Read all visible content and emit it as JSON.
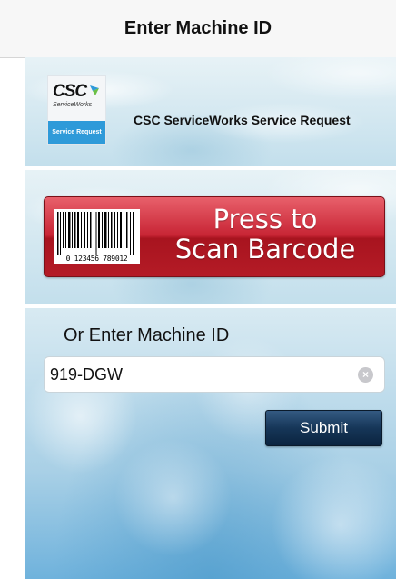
{
  "nav": {
    "title": "Enter Machine ID"
  },
  "header": {
    "logo": {
      "brand": "CSC",
      "sub": "ServiceWorks",
      "band": "Service Request"
    },
    "app_name": "CSC ServiceWorks Service Request"
  },
  "scan": {
    "line1": "Press to",
    "line2": "Scan Barcode",
    "barcode_number": "0 123456 789012",
    "colors": {
      "button": "#c82535"
    }
  },
  "manual": {
    "label": "Or Enter Machine ID",
    "input_value": "919-DGW",
    "clear_icon": "clear-icon",
    "submit_label": "Submit",
    "colors": {
      "submit": "#163658"
    }
  }
}
